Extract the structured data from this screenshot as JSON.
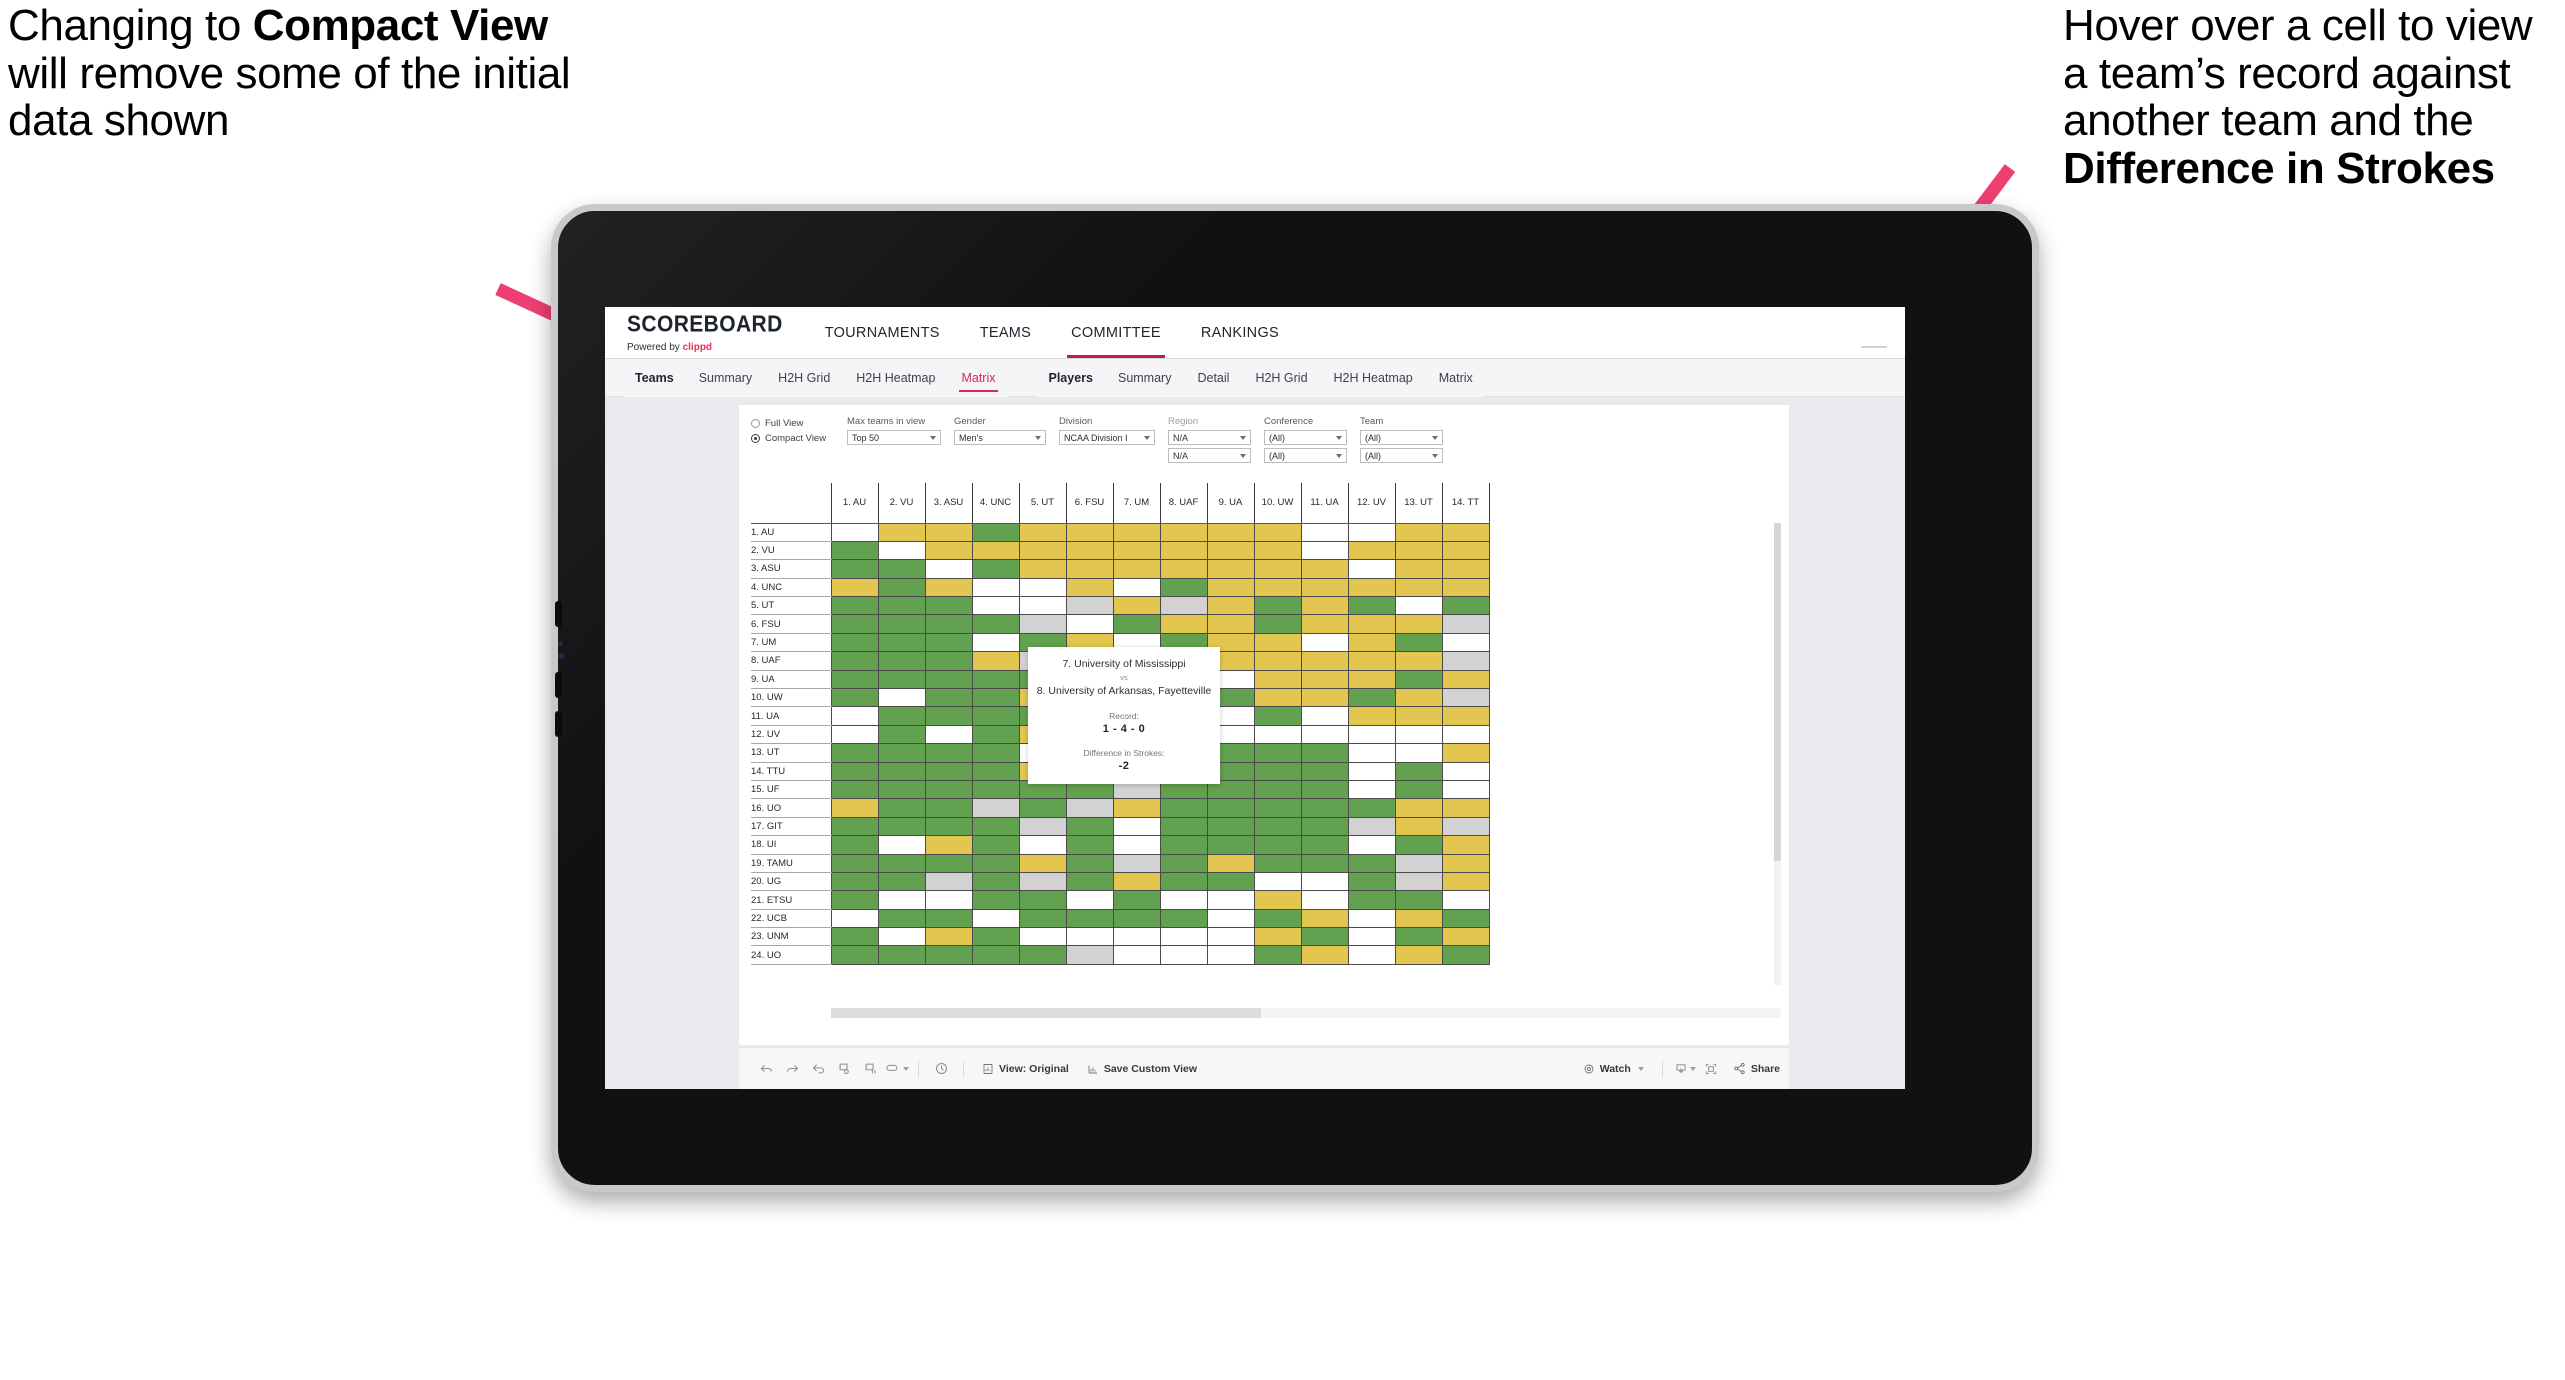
{
  "annotations": {
    "left": {
      "pre": "Changing to ",
      "bold": "Compact View",
      "post": " will remove some of the initial data shown"
    },
    "right": {
      "pre": "Hover over a cell to view a team’s record against another team and the ",
      "bold": "Difference in Strokes",
      "post": ""
    },
    "arrow_color": "#ef3f72"
  },
  "app": {
    "brand": {
      "title": "SCOREBOARD",
      "powered_prefix": "Powered by ",
      "powered_name": "clippd"
    },
    "topnav": [
      {
        "label": "TOURNAMENTS",
        "active": false
      },
      {
        "label": "TEAMS",
        "active": false
      },
      {
        "label": "COMMITTEE",
        "active": true
      },
      {
        "label": "RANKINGS",
        "active": false
      }
    ],
    "subnav": {
      "group1_label": "Teams",
      "group1_tabs": [
        {
          "label": "Summary",
          "active": false
        },
        {
          "label": "H2H Grid",
          "active": false
        },
        {
          "label": "H2H Heatmap",
          "active": false
        },
        {
          "label": "Matrix",
          "active": true
        }
      ],
      "group2_label": "Players",
      "group2_tabs": [
        {
          "label": "Summary",
          "active": false
        },
        {
          "label": "Detail",
          "active": false
        },
        {
          "label": "H2H Grid",
          "active": false
        },
        {
          "label": "H2H Heatmap",
          "active": false
        },
        {
          "label": "Matrix",
          "active": false
        }
      ]
    },
    "filters": {
      "view_mode": {
        "full_label": "Full View",
        "compact_label": "Compact View",
        "selected": "Compact View"
      },
      "max_teams": {
        "label": "Max teams in view",
        "value": "Top 50"
      },
      "gender": {
        "label": "Gender",
        "value": "Men's"
      },
      "division": {
        "label": "Division",
        "value": "NCAA Division I"
      },
      "region": {
        "label": "Region",
        "value1": "N/A",
        "value2": "N/A"
      },
      "conference": {
        "label": "Conference",
        "value1": "(All)",
        "value2": "(All)"
      },
      "team": {
        "label": "Team",
        "value1": "(All)",
        "value2": "(All)"
      }
    },
    "tooltip": {
      "team_a": "7. University of Mississippi",
      "vs": "vs",
      "team_b": "8. University of Arkansas, Fayetteville",
      "record_label": "Record:",
      "record_value": "1 - 4 - 0",
      "diff_label": "Difference in Strokes:",
      "diff_value": "-2"
    },
    "toolbar": {
      "icons": [
        "undo-icon",
        "redo-icon",
        "revert-icon",
        "refresh-icon",
        "pause-icon",
        "highlight-icon"
      ],
      "view_original": "View: Original",
      "save_custom_view": "Save Custom View",
      "watch": "Watch",
      "share": "Share"
    }
  },
  "chart_data": {
    "type": "heatmap",
    "title": "Head-to-Head Team Matrix",
    "legend": {
      "win": "#62a150",
      "loss": "#e2c64f",
      "tie": "#d2d2d2",
      "none": "#ffffff"
    },
    "columns": [
      "1. AU",
      "2. VU",
      "3. ASU",
      "4. UNC",
      "5. UT",
      "6. FSU",
      "7. UM",
      "8. UAF",
      "9. UA",
      "10. UW",
      "11. UA",
      "12. UV",
      "13. UT",
      "14. TT"
    ],
    "rows": [
      "1. AU",
      "2. VU",
      "3. ASU",
      "4. UNC",
      "5. UT",
      "6. FSU",
      "7. UM",
      "8. UAF",
      "9. UA",
      "10. UW",
      "11. UA",
      "12. UV",
      "13. UT",
      "14. TTU",
      "15. UF",
      "16. UO",
      "17. GIT",
      "18. UI",
      "19. TAMU",
      "20. UG",
      "21. ETSU",
      "22. UCB",
      "23. UNM",
      "24. UO"
    ],
    "cells": [
      [
        "w",
        "y",
        "y",
        "g",
        "y",
        "y",
        "y",
        "y",
        "y",
        "y",
        "w",
        "w",
        "y",
        "y"
      ],
      [
        "g",
        "w",
        "y",
        "y",
        "y",
        "y",
        "y",
        "y",
        "y",
        "y",
        "w",
        "y",
        "y",
        "y"
      ],
      [
        "g",
        "g",
        "w",
        "g",
        "y",
        "y",
        "y",
        "y",
        "y",
        "y",
        "y",
        "w",
        "y",
        "y"
      ],
      [
        "y",
        "g",
        "y",
        "w",
        "w",
        "y",
        "w",
        "g",
        "y",
        "y",
        "y",
        "y",
        "y",
        "y"
      ],
      [
        "g",
        "g",
        "g",
        "w",
        "w",
        "gr",
        "y",
        "gr",
        "y",
        "g",
        "y",
        "g",
        "w",
        "g"
      ],
      [
        "g",
        "g",
        "g",
        "g",
        "gr",
        "w",
        "g",
        "y",
        "y",
        "g",
        "y",
        "y",
        "y",
        "gr"
      ],
      [
        "g",
        "g",
        "g",
        "w",
        "g",
        "y",
        "w",
        "g",
        "y",
        "y",
        "w",
        "y",
        "g",
        "w"
      ],
      [
        "g",
        "g",
        "g",
        "y",
        "gr",
        "g",
        "y",
        "w",
        "y",
        "y",
        "y",
        "y",
        "y",
        "gr"
      ],
      [
        "g",
        "g",
        "g",
        "g",
        "g",
        "g",
        "g",
        "y",
        "w",
        "y",
        "y",
        "y",
        "g",
        "y"
      ],
      [
        "g",
        "w",
        "g",
        "g",
        "y",
        "y",
        "w",
        "g",
        "g",
        "y",
        "y",
        "g",
        "y",
        "gr"
      ],
      [
        "w",
        "g",
        "g",
        "g",
        "g",
        "g",
        "g",
        "g",
        "w",
        "g",
        "w",
        "y",
        "y",
        "y"
      ],
      [
        "w",
        "g",
        "w",
        "g",
        "y",
        "g",
        "y",
        "g",
        "w",
        "w",
        "w",
        "w",
        "w",
        "w"
      ],
      [
        "g",
        "g",
        "g",
        "g",
        "w",
        "g",
        "w",
        "g",
        "g",
        "g",
        "g",
        "w",
        "w",
        "y"
      ],
      [
        "g",
        "g",
        "g",
        "g",
        "y",
        "gr",
        "y",
        "g",
        "g",
        "g",
        "g",
        "w",
        "g",
        "w"
      ],
      [
        "g",
        "g",
        "g",
        "g",
        "g",
        "g",
        "gr",
        "g",
        "g",
        "g",
        "g",
        "w",
        "g",
        "w"
      ],
      [
        "y",
        "g",
        "g",
        "gr",
        "g",
        "gr",
        "y",
        "g",
        "g",
        "g",
        "g",
        "g",
        "y",
        "y"
      ],
      [
        "g",
        "g",
        "g",
        "g",
        "gr",
        "g",
        "w",
        "g",
        "g",
        "g",
        "g",
        "gr",
        "y",
        "gr"
      ],
      [
        "g",
        "w",
        "y",
        "g",
        "w",
        "g",
        "w",
        "g",
        "g",
        "g",
        "g",
        "w",
        "g",
        "y"
      ],
      [
        "g",
        "g",
        "g",
        "g",
        "y",
        "g",
        "gr",
        "g",
        "y",
        "g",
        "g",
        "g",
        "gr",
        "y"
      ],
      [
        "g",
        "g",
        "gr",
        "g",
        "gr",
        "g",
        "y",
        "g",
        "g",
        "w",
        "w",
        "g",
        "gr",
        "y"
      ],
      [
        "g",
        "w",
        "w",
        "g",
        "g",
        "w",
        "g",
        "w",
        "w",
        "y",
        "w",
        "g",
        "g",
        "w"
      ],
      [
        "w",
        "g",
        "g",
        "w",
        "g",
        "g",
        "g",
        "g",
        "w",
        "g",
        "y",
        "w",
        "y",
        "g"
      ],
      [
        "g",
        "w",
        "y",
        "g",
        "w",
        "w",
        "w",
        "w",
        "w",
        "y",
        "g",
        "w",
        "g",
        "y"
      ],
      [
        "g",
        "g",
        "g",
        "g",
        "g",
        "gr",
        "w",
        "w",
        "w",
        "g",
        "y",
        "w",
        "y",
        "g"
      ]
    ]
  }
}
